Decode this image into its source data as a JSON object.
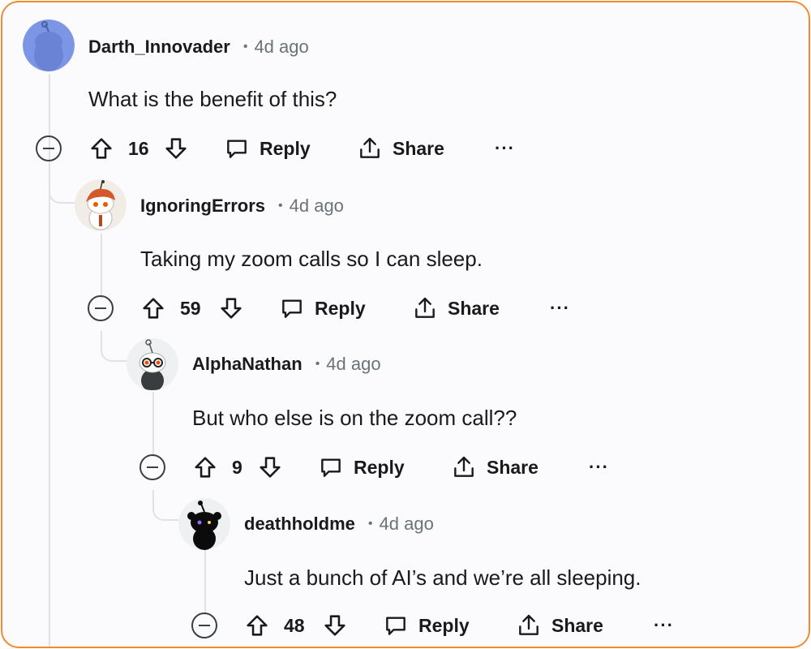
{
  "comments": [
    {
      "username": "Darth_Innovader",
      "time": "4d ago",
      "body": "What is the benefit of this?",
      "score": "16",
      "reply_label": "Reply",
      "share_label": "Share",
      "more_label": "···",
      "avatar_color": "#7c95e4"
    },
    {
      "username": "IgnoringErrors",
      "time": "4d ago",
      "body": "Taking my zoom calls so I can sleep.",
      "score": "59",
      "reply_label": "Reply",
      "share_label": "Share",
      "more_label": "···",
      "avatar_color": "#f1ece6"
    },
    {
      "username": "AlphaNathan",
      "time": "4d ago",
      "body": "But who else is on the zoom call??",
      "score": "9",
      "reply_label": "Reply",
      "share_label": "Share",
      "more_label": "···",
      "avatar_color": "#eef0f2"
    },
    {
      "username": "deathholdme",
      "time": "4d ago",
      "body": "Just a bunch of AI’s and we’re all sleeping.",
      "score": "48",
      "reply_label": "Reply",
      "share_label": "Share",
      "more_label": "···",
      "avatar_color": "#eef0f2"
    }
  ],
  "separator": "•",
  "icons": [
    "upvote-icon",
    "downvote-icon",
    "reply-bubble-icon",
    "share-icon",
    "collapse-icon",
    "more-options-icon"
  ],
  "colors": {
    "border": "#f28a2e",
    "thread_line": "#dfe3e7",
    "text": "#1a1a1b",
    "muted": "#6b7379"
  }
}
